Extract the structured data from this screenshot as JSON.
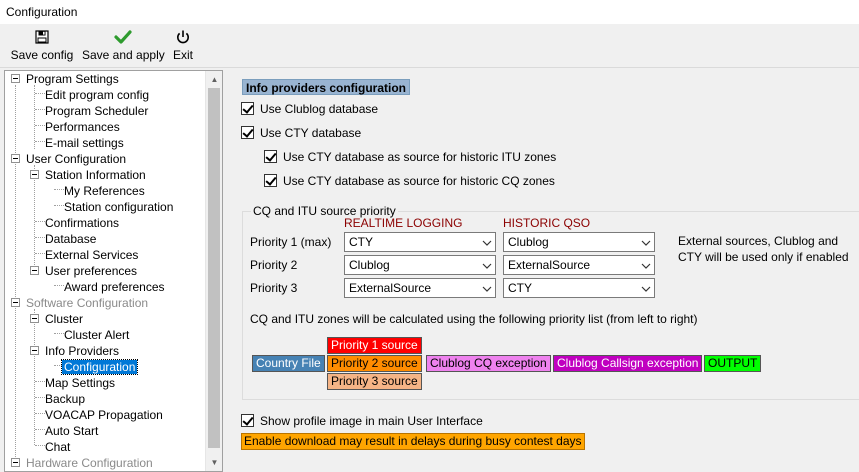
{
  "window": {
    "title": "Configuration"
  },
  "toolbar": {
    "buttons": [
      {
        "label": "Save config",
        "icon": "floppy-disk-icon"
      },
      {
        "label": "Save and apply",
        "icon": "checkmark-icon"
      },
      {
        "label": "Exit",
        "icon": "power-icon"
      }
    ]
  },
  "tree": {
    "items": [
      {
        "label": "Program Settings"
      },
      {
        "label": "Edit program config"
      },
      {
        "label": "Program Scheduler"
      },
      {
        "label": "Performances"
      },
      {
        "label": "E-mail settings"
      },
      {
        "label": "User Configuration"
      },
      {
        "label": "Station Information"
      },
      {
        "label": "My References"
      },
      {
        "label": "Station configuration"
      },
      {
        "label": "Confirmations"
      },
      {
        "label": "Database"
      },
      {
        "label": "External Services"
      },
      {
        "label": "User preferences"
      },
      {
        "label": "Award preferences"
      },
      {
        "label": "Software Configuration"
      },
      {
        "label": "Cluster"
      },
      {
        "label": "Cluster Alert"
      },
      {
        "label": "Info Providers"
      },
      {
        "label": "Configuration"
      },
      {
        "label": "Map Settings"
      },
      {
        "label": "Backup"
      },
      {
        "label": "VOACAP Propagation"
      },
      {
        "label": "Auto Start"
      },
      {
        "label": "Chat"
      },
      {
        "label": "Hardware Configuration"
      }
    ],
    "selected": "Configuration"
  },
  "main": {
    "title": "Info providers configuration",
    "checkboxes": {
      "use_clublog": "Use Clublog database",
      "use_cty": "Use CTY database",
      "cty_itu": "Use CTY database as source for historic ITU zones",
      "cty_cq": "Use CTY database as source for historic CQ zones",
      "show_profile": "Show profile image in main User Interface"
    },
    "priority_group": {
      "legend": "CQ and ITU source priority",
      "col_realtime": "REALTIME LOGGING",
      "col_historic": "HISTORIC QSO",
      "rows": [
        {
          "label": "Priority 1 (max)",
          "realtime": "CTY",
          "historic": "Clublog"
        },
        {
          "label": "Priority 2",
          "realtime": "Clublog",
          "historic": "ExternalSource"
        },
        {
          "label": "Priority 3",
          "realtime": "ExternalSource",
          "historic": "CTY"
        }
      ],
      "note_line1": "External sources, Clublog and",
      "note_line2": "CTY will be used only if enabled",
      "priority_text": "CQ and ITU zones will be calculated using the following priority list (from left to right)"
    },
    "flow": {
      "country_file": "Country File",
      "p1": "Priority 1 source",
      "p2": "Priority 2 source",
      "p3": "Priority 3 source",
      "clublog_cq": "Clublog CQ exception",
      "clublog_callsign": "Clublog Callsign exception",
      "output": "OUTPUT"
    },
    "warning": "Enable download may result in delays during busy contest days"
  },
  "colors": {
    "country_file": "#4682b4",
    "p1": "#ff0000",
    "p2": "#ff8c00",
    "p3": "#f5b486",
    "clublog_cq": "#ee82ee",
    "clublog_callsign": "#c000c0",
    "output": "#00ff00",
    "warning": "#ffa500",
    "column_header": "#8b0000"
  }
}
